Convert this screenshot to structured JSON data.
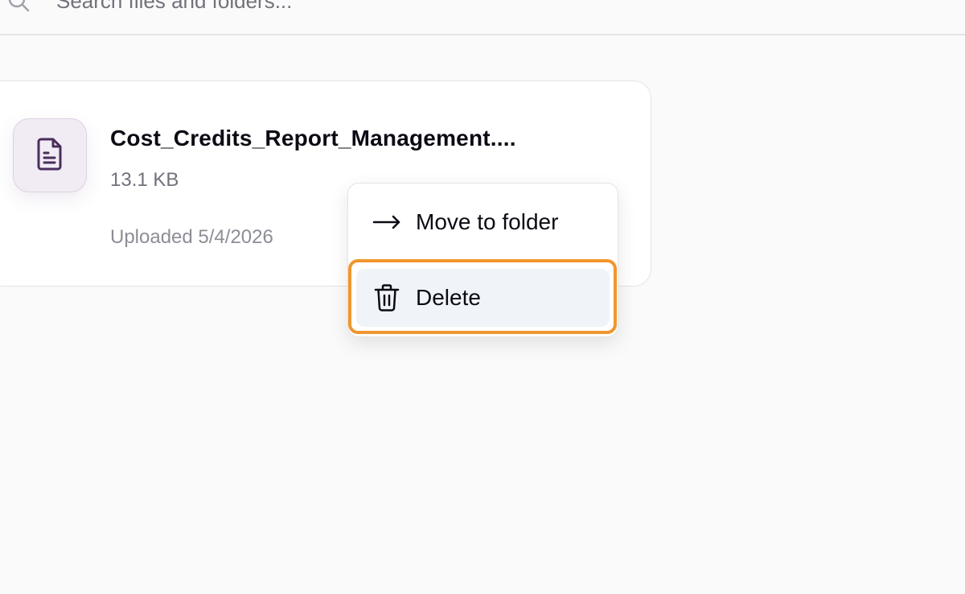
{
  "search": {
    "placeholder": "Search files and folders..."
  },
  "file": {
    "name": "Cost_Credits_Report_Management....",
    "size": "13.1 KB",
    "uploaded": "Uploaded 5/4/2026",
    "icon": "document-icon"
  },
  "context_menu": {
    "items": [
      {
        "label": "Move to folder",
        "icon": "arrow-right-icon"
      },
      {
        "label": "Delete",
        "icon": "trash-icon"
      }
    ]
  },
  "colors": {
    "highlight": "#f0962e",
    "file_icon_bg": "#f1ecf4",
    "file_icon_stroke": "#4a2d5c",
    "delete_bg": "#f0f4f8"
  }
}
